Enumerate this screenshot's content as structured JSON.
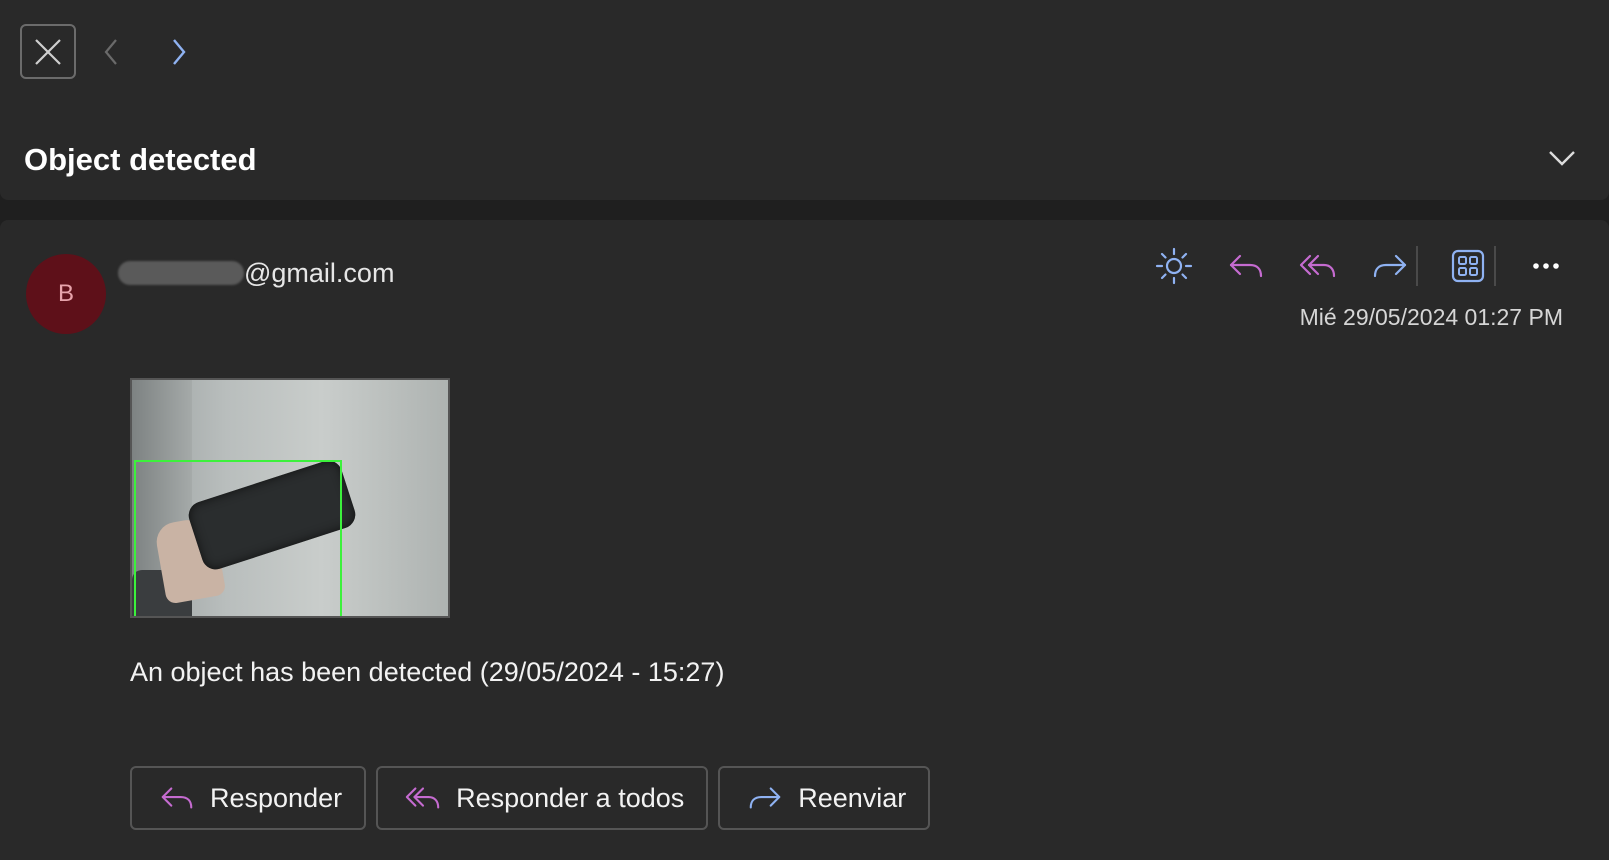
{
  "top": {
    "subject": "Object detected"
  },
  "message": {
    "avatar_initial": "B",
    "sender_suffix": "@gmail.com",
    "date": "Mié 29/05/2024 01:27 PM",
    "body": "An object has been detected (29/05/2024 - 15:27)"
  },
  "toolbar": {
    "icons": [
      "sun-icon",
      "reply-icon",
      "reply-all-icon",
      "forward-icon",
      "apps-icon",
      "more-icon"
    ]
  },
  "actions": {
    "reply_label": "Responder",
    "reply_all_label": "Responder a todos",
    "forward_label": "Reenviar"
  },
  "colors": {
    "accent_purple": "#c56bd0",
    "accent_blue": "#8fb2f2",
    "avatar_bg": "#5e1019",
    "detection_box": "#3cf13c"
  }
}
